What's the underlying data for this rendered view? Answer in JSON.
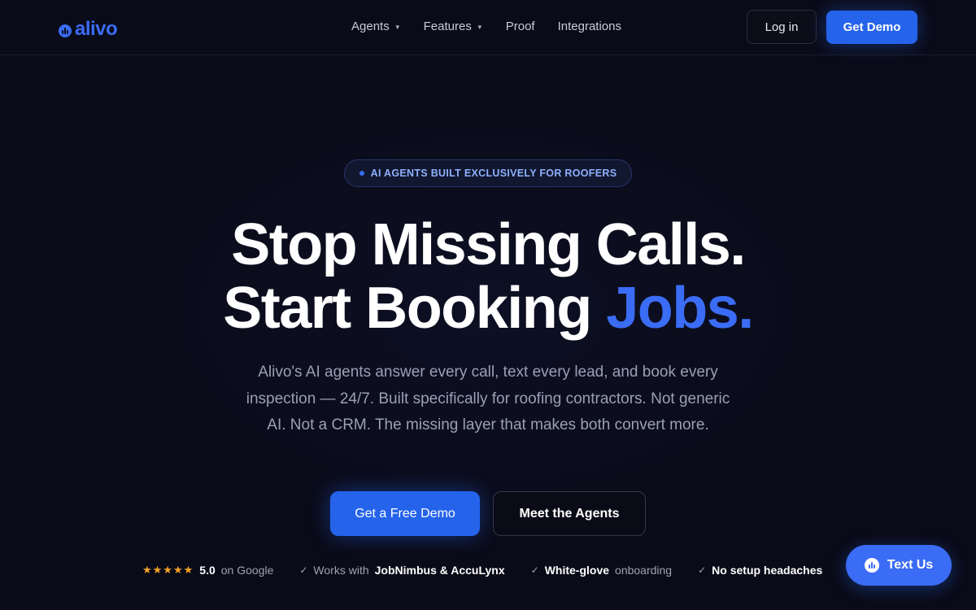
{
  "nav": {
    "logo_text": "alivo",
    "links": [
      {
        "label": "Agents",
        "has_dropdown": true
      },
      {
        "label": "Features",
        "has_dropdown": true
      },
      {
        "label": "Proof",
        "has_dropdown": false
      },
      {
        "label": "Integrations",
        "has_dropdown": false
      }
    ],
    "login_label": "Log in",
    "demo_label": "Get Demo"
  },
  "hero": {
    "badge": "AI AGENTS BUILT EXCLUSIVELY FOR ROOFERS",
    "headline_line1": "Stop Missing Calls.",
    "headline_line2_prefix": "Start Booking ",
    "headline_line2_accent": "Jobs.",
    "subtitle": "Alivo's AI agents answer every call, text every lead, and book every inspection — 24/7. Built specifically for roofing contractors. Not generic AI. Not a CRM. The missing layer that makes both convert more.",
    "cta_primary": "Get a Free Demo",
    "cta_secondary": "Meet the Agents"
  },
  "trust": {
    "stars": "★★★★★",
    "rating": "5.0",
    "rating_source": "on Google",
    "item2_prefix": "Works with",
    "item2_strong": "JobNimbus & AccuLynx",
    "item3_strong": "White-glove",
    "item3_suffix": "onboarding",
    "item4_strong": "No setup headaches"
  },
  "chat": {
    "label": "Text Us"
  },
  "colors": {
    "background": "#0a0b18",
    "accent": "#3b6cf6",
    "button_blue": "#2563eb",
    "star": "#f5a524"
  }
}
